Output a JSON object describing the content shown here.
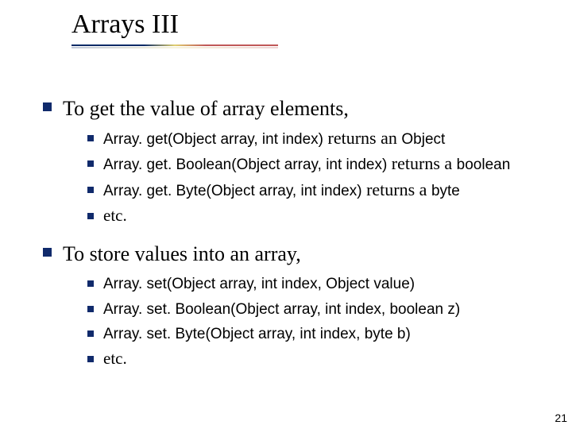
{
  "title": "Arrays III",
  "section1": {
    "heading": "To get the value of array elements,",
    "items": [
      {
        "code": "Array. get(Object array, int index)",
        "mid": " returns an ",
        "tail": "Object"
      },
      {
        "code1": "Array. get. Boolean(Object array, int index)",
        "mid": " returns a ",
        "tail": "boolean"
      },
      {
        "code1": "Array. get. Byte(Object array, int index)",
        "mid": " returns a ",
        "tail": "byte"
      },
      {
        "plain": "etc."
      }
    ]
  },
  "section2": {
    "heading": "To store values into an array,",
    "items": [
      {
        "code": "Array. set(Object array, int index, Object value)"
      },
      {
        "code": "Array. set. Boolean(Object array, int index, boolean z)"
      },
      {
        "code": "Array. set. Byte(Object array, int index, byte b)"
      },
      {
        "plain": "etc."
      }
    ]
  },
  "page_number": "21"
}
